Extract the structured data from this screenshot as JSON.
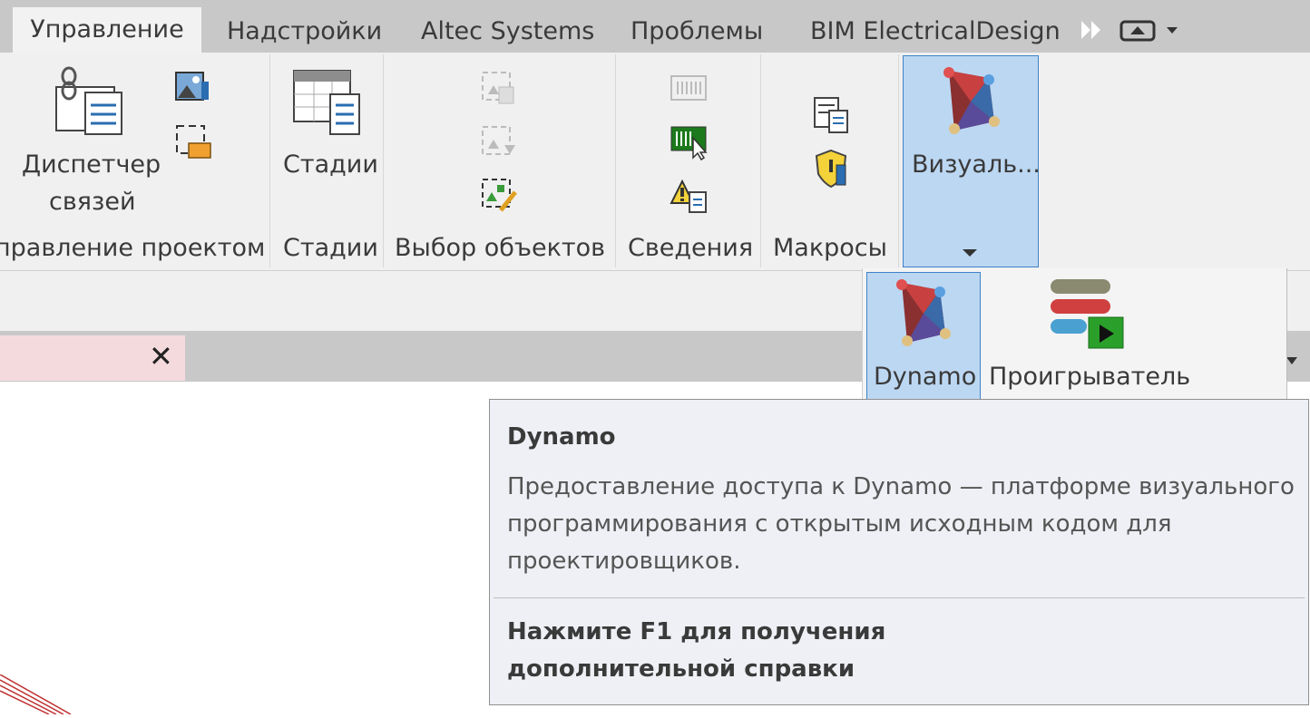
{
  "tabs": [
    "Управление",
    "Надстройки",
    "Altec Systems",
    "Проблемы",
    "BIM ElectricalDesign"
  ],
  "ribbon": {
    "link_manager_label_line1": "Диспетчер",
    "link_manager_label_line2": "связей",
    "phases_button_label": "Стадии",
    "visual_button_label": "Визуаль...",
    "panels": [
      "правление проектом",
      "Стадии",
      "Выбор объектов",
      "Сведения",
      "Макросы"
    ]
  },
  "dropdown": {
    "dynamo_label": "Dynamo",
    "player_label": "Проигрыватель"
  },
  "tooltip": {
    "title": "Dynamo",
    "body": "Предоставление доступа к Dynamo — платформе визуального программирования с открытым исходным кодом для проектировщиков.",
    "help_line1": "Нажмите F1 для получения",
    "help_line2": "дополнительной справки"
  },
  "doc_tab": {
    "close_glyph": "✕"
  },
  "colors": {
    "tab_bar": "#c8c8c8",
    "ribbon_bg": "#f0f0f0",
    "selected_blue": "#bcd7f2",
    "selected_border": "#3f82c6",
    "doc_tab_pink": "#f5dadd",
    "tooltip_bg": "#eef0f5"
  },
  "icons": [
    "link-manager-icon",
    "decal-icon",
    "manage-images-icon",
    "phases-icon",
    "select-links-icon",
    "select-underlay-icon",
    "select-pinned-icon",
    "ids-icon",
    "select-by-id-icon",
    "warnings-icon",
    "macro-manager-icon",
    "macro-security-icon",
    "dynamo-icon",
    "dynamo-player-icon"
  ]
}
